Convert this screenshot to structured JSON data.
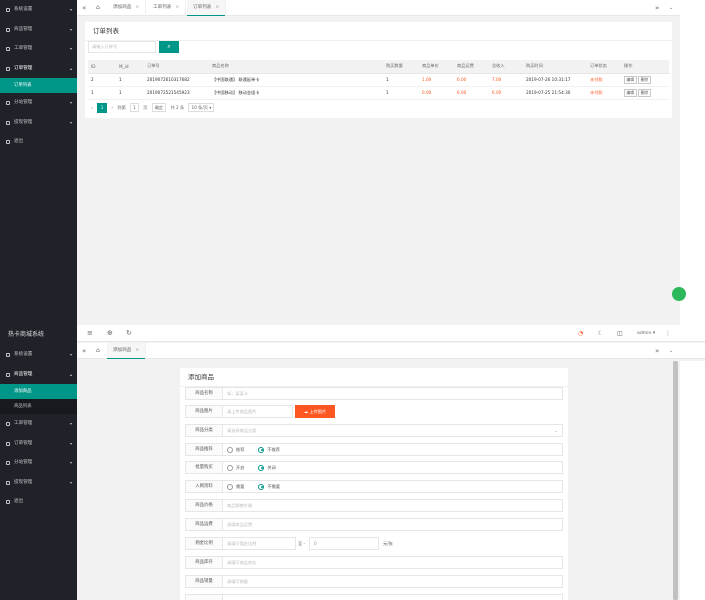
{
  "panel1": {
    "sidebar": {
      "items": [
        {
          "label": "系统设置",
          "arrow": "▾"
        },
        {
          "label": "商品管理",
          "arrow": "▾"
        },
        {
          "label": "工单管理",
          "arrow": "▾"
        },
        {
          "label": "订单管理",
          "arrow": "▴"
        },
        {
          "label": "订单列表"
        },
        {
          "label": "分站管理",
          "arrow": "▾"
        },
        {
          "label": "提现管理",
          "arrow": "▾"
        },
        {
          "label": "退出"
        }
      ]
    },
    "tabs": [
      {
        "label": "添加商品"
      },
      {
        "label": "工单列表"
      },
      {
        "label": "订单列表"
      }
    ],
    "card_title": "订单列表",
    "search_placeholder": "请输入订单号",
    "table": {
      "headers": [
        "ID",
        "M_id",
        "订单号",
        "商品名称",
        "购买数量",
        "商品单价",
        "商品运费",
        "总收入",
        "购买时间",
        "订单状态",
        "操作"
      ],
      "rows": [
        {
          "id": "2",
          "mid": "1",
          "order_no": "2019072610317682",
          "product": "【中国联通】 联通延单卡",
          "qty": "1",
          "price": "1.00",
          "freight": "6.00",
          "income": "7.00",
          "time": "2019-07-26 10:31:17",
          "status": "未付款"
        },
        {
          "id": "1",
          "mid": "1",
          "order_no": "2019072521545923",
          "product": "【中国移动】 移动金组卡",
          "qty": "1",
          "price": "0.00",
          "freight": "6.00",
          "income": "6.00",
          "time": "2019-07-25 21:54:30",
          "status": "未付款"
        }
      ],
      "action_buttons": [
        "编辑",
        "删除"
      ]
    },
    "pager": {
      "prev": "‹",
      "current": "1",
      "next": "›",
      "goto_label": "到第",
      "page_value": "1",
      "page_unit": "页",
      "confirm": "确定",
      "total": "共 2 条",
      "per_page": "10 条/页 ▾"
    }
  },
  "panel2": {
    "app_title": "热卡商城系统",
    "user": "admin ▾",
    "sidebar": {
      "items": [
        {
          "label": "系统设置",
          "arrow": "▾"
        },
        {
          "label": "商品管理",
          "arrow": "▴"
        },
        {
          "label": "添加商品"
        },
        {
          "label": "商品列表"
        },
        {
          "label": "工单管理",
          "arrow": "▾"
        },
        {
          "label": "订单管理",
          "arrow": "▾"
        },
        {
          "label": "分站管理",
          "arrow": "▾"
        },
        {
          "label": "提现管理",
          "arrow": "▾"
        },
        {
          "label": "退出"
        }
      ]
    },
    "tabs": [
      {
        "label": "添加商品"
      }
    ],
    "form_title": "添加商品",
    "form": {
      "name": {
        "label": "商品名称",
        "placeholder": "如：某某卡"
      },
      "image": {
        "label": "商品图片",
        "placeholder": "请上传商品图片",
        "upload": "上传图片"
      },
      "category": {
        "label": "商品分类",
        "placeholder": "请选择商品分类"
      },
      "recommend": {
        "label": "商品推荐",
        "opt1": "推荐",
        "opt2": "不推荐"
      },
      "batch": {
        "label": "批量购买",
        "opt1": "开启",
        "opt2": "关闭"
      },
      "idcard": {
        "label": "入网资料",
        "opt1": "需要",
        "opt2": "不需要"
      },
      "price": {
        "label": "商品价格",
        "placeholder": "商品销售价格"
      },
      "freight": {
        "label": "商品运费",
        "placeholder": "请填商品运费"
      },
      "commission": {
        "label": "佣金比例",
        "placeholder": "请填写佣金比例",
        "sep": "至 -",
        "value": "0",
        "unit": "元/张"
      },
      "stock": {
        "label": "商品库存",
        "placeholder": "请填写商品库存"
      },
      "sales": {
        "label": "商品销量",
        "placeholder": "请填写销量"
      }
    }
  }
}
